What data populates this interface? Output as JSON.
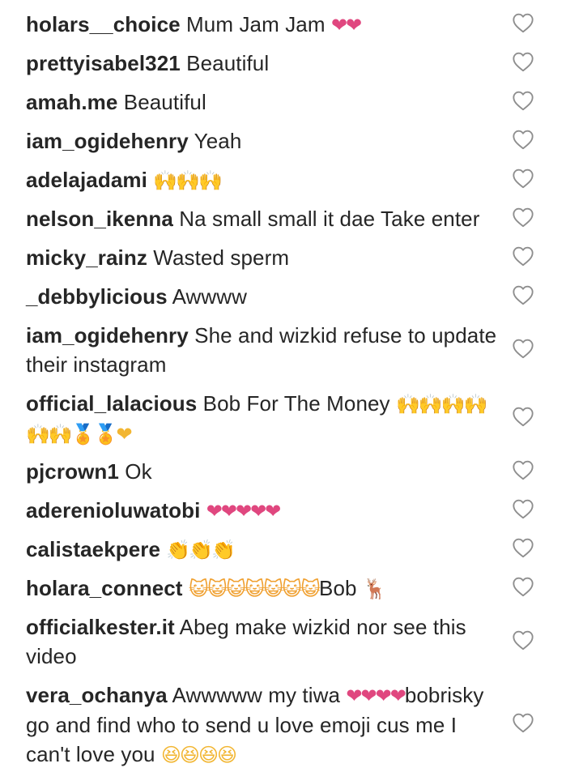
{
  "comments": [
    {
      "username": "holars__choice",
      "text": "Mum Jam Jam",
      "emoji": "❤❤",
      "emoji_kind": "heart"
    },
    {
      "username": "prettyisabel321",
      "text": "Beautiful",
      "emoji": "",
      "emoji_kind": ""
    },
    {
      "username": "amah.me",
      "text": "Beautiful",
      "emoji": "",
      "emoji_kind": ""
    },
    {
      "username": "iam_ogidehenry",
      "text": "Yeah",
      "emoji": "",
      "emoji_kind": ""
    },
    {
      "username": "adelajadami",
      "text": "",
      "emoji": "🙌🙌🙌",
      "emoji_kind": "hands"
    },
    {
      "username": "nelson_ikenna",
      "text": "Na small small it dae Take enter",
      "emoji": "",
      "emoji_kind": ""
    },
    {
      "username": "micky_rainz",
      "text": "Wasted sperm",
      "emoji": "",
      "emoji_kind": ""
    },
    {
      "username": "_debbylicious",
      "text": "Awwww",
      "emoji": "",
      "emoji_kind": ""
    },
    {
      "username": "iam_ogidehenry",
      "text": "She and wizkid refuse to update their instagram",
      "emoji": "",
      "emoji_kind": ""
    },
    {
      "username": "official_lalacious",
      "text": "Bob For The Money",
      "emoji": "🙌🙌🙌🙌🙌🙌🏅🏅❤",
      "emoji_kind": "hands"
    },
    {
      "username": "pjcrown1",
      "text": "Ok",
      "emoji": "",
      "emoji_kind": ""
    },
    {
      "username": "aderenioluwatobi",
      "text": "",
      "emoji": "❤❤❤❤❤",
      "emoji_kind": "heart"
    },
    {
      "username": "calistaekpere",
      "text": "",
      "emoji": "👏👏👏",
      "emoji_kind": "hands"
    },
    {
      "username": "holara_connect",
      "text": "",
      "emoji": "😺😺😺😺😺😺😺",
      "emoji_kind": "cat",
      "text_after": "Bob",
      "emoji_after": "🦌",
      "emoji_after_kind": "deer"
    },
    {
      "username": "officialkester.it",
      "text": "Abeg make wizkid nor see this video",
      "emoji": "",
      "emoji_kind": ""
    },
    {
      "username": "vera_ochanya",
      "text": "Awwwww my tiwa",
      "emoji": "❤❤❤❤",
      "emoji_kind": "heart",
      "text_after": "bobrisky go and find who to send u love emoji cus me I can't love you",
      "emoji_after": "😆😆😆😆",
      "emoji_after_kind": "face"
    }
  ],
  "icons": {
    "like": "heart-outline-icon"
  },
  "colors": {
    "text": "#262626",
    "heart_emoji": "#e0477f",
    "like_icon": "#8e8e8e",
    "background": "#ffffff"
  }
}
